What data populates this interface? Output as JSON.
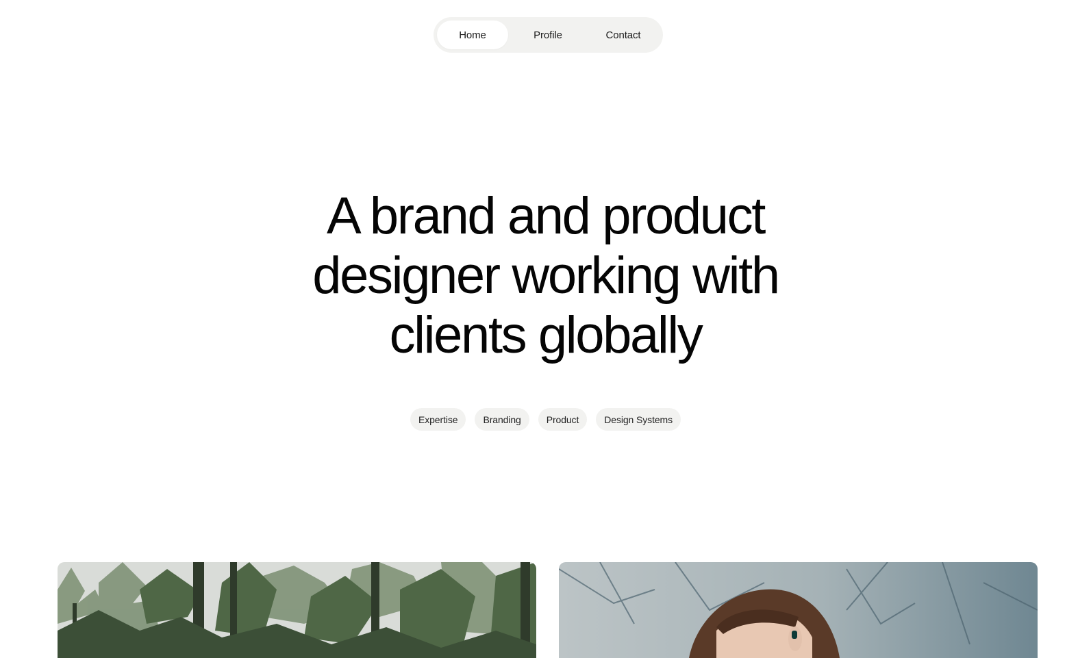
{
  "nav": {
    "items": [
      {
        "label": "Home",
        "active": true
      },
      {
        "label": "Profile",
        "active": false
      },
      {
        "label": "Contact",
        "active": false
      }
    ]
  },
  "hero": {
    "lines": [
      "A brand and product",
      "designer working with",
      "clients globally"
    ]
  },
  "tags": [
    "Expertise",
    "Branding",
    "Product",
    "Design Systems"
  ],
  "colors": {
    "background": "#ffffff",
    "pill_bg": "#f2f2f0",
    "text": "#050505"
  }
}
